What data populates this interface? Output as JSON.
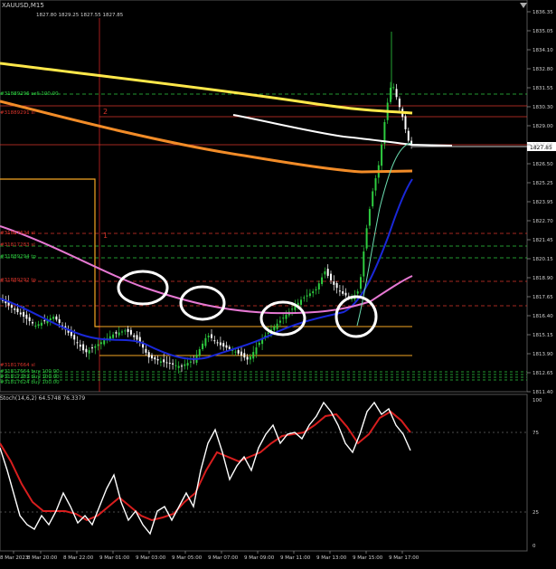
{
  "window": {
    "title": "XAUUSD,M15",
    "ohlc": [
      "1827.80",
      "1829.25",
      "1827.55",
      "1827.85"
    ]
  },
  "price_panel": {
    "price_axis": [
      "1836.35",
      "1835.05",
      "1834.10",
      "1832.80",
      "1831.55",
      "1830.30",
      "1829.00",
      "1827.85",
      "1826.50",
      "1825.25",
      "1823.95",
      "1822.70",
      "1821.45",
      "1820.15",
      "1818.90",
      "1817.65",
      "1816.40",
      "1815.15",
      "1813.90",
      "1812.65",
      "1811.40"
    ],
    "current_price_tag": "1827.85",
    "order_labels": [
      "#31889296 sell 100.00",
      "#31889291 sl",
      "#31817624 sl",
      "#31817283 sl",
      "#31889294 tp",
      "#31889292 tp",
      "#31817664 sl",
      "#31817664 buy 100.00",
      "#31817283 buy 100.00",
      "#31817624 buy 100.00"
    ],
    "level_marks": [
      "2",
      "1"
    ]
  },
  "indicator_panel": {
    "label": "Stoch(14,6,2) 64.5748 76.3379",
    "levels": [
      "100",
      "75",
      "25",
      "0"
    ]
  },
  "time_axis": [
    "8 Mar 2023",
    "8 Mar 20:00",
    "8 Mar 22:00",
    "9 Mar 01:00",
    "9 Mar 03:00",
    "9 Mar 05:00",
    "9 Mar 07:00",
    "9 Mar 09:00",
    "9 Mar 11:00",
    "9 Mar 13:00",
    "9 Mar 15:00",
    "9 Mar 17:00"
  ],
  "colors": {
    "background": "#000000",
    "bull_candle": "#2ecc40",
    "bear_candle": "#ffffff",
    "ma_yellow": "#ffe84a",
    "ma_orange": "#f28c28",
    "ma_white": "#ffffff",
    "ma_blue": "#1a28d8",
    "ma_pink": "#e678d2",
    "bb_green": "#6bdcb0",
    "stoch_main": "#ffffff",
    "stoch_signal": "#d81e1e",
    "order_red": "#d9342b",
    "order_green": "#2ecc40",
    "order_orange": "#f5a623"
  }
}
